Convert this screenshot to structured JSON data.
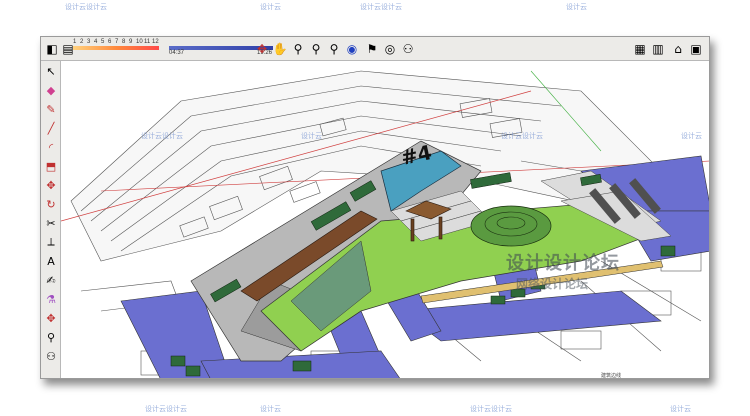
{
  "shadow_settings": {
    "months": [
      "1",
      "2",
      "3",
      "4",
      "5",
      "6",
      "7",
      "8",
      "9",
      "10",
      "11",
      "12"
    ],
    "time_start": "04:37",
    "time_end": "19:26",
    "accent_month": "#ff6a3d",
    "accent_time": "#3a4db0"
  },
  "toolbar": {
    "icons": [
      "orbit-icon",
      "pan-icon",
      "zoom-icon",
      "zoom-window-icon",
      "zoom-extents-icon",
      "previous-view-icon",
      "position-camera-icon",
      "look-around-icon",
      "walk-icon"
    ],
    "right_icons": [
      "components-icon",
      "layers-icon",
      "home-icon",
      "export-icon"
    ]
  },
  "side_tools": [
    "select-icon",
    "eraser-icon",
    "pencil-icon",
    "line-icon",
    "arc-icon",
    "push-pull-icon",
    "move-icon",
    "rotate-icon",
    "offset-icon",
    "tape-measure-icon",
    "dimension-icon",
    "text-icon",
    "paint-bucket-icon",
    "orbit-icon",
    "zoom-icon",
    "walk-icon"
  ],
  "model": {
    "building_label": "#4",
    "status_text": "建筑边线"
  },
  "overlay": {
    "title": "设计设计论坛",
    "subtitle": "网络设计论坛"
  },
  "watermarks": [
    "设计云设计云",
    "设计云",
    "设计云设计云",
    "设计云",
    "设计云设计云",
    "设计云",
    "设计云设计云",
    "设计云",
    "设计云设计云",
    "设计云",
    "设计云设计云",
    "设计云"
  ]
}
